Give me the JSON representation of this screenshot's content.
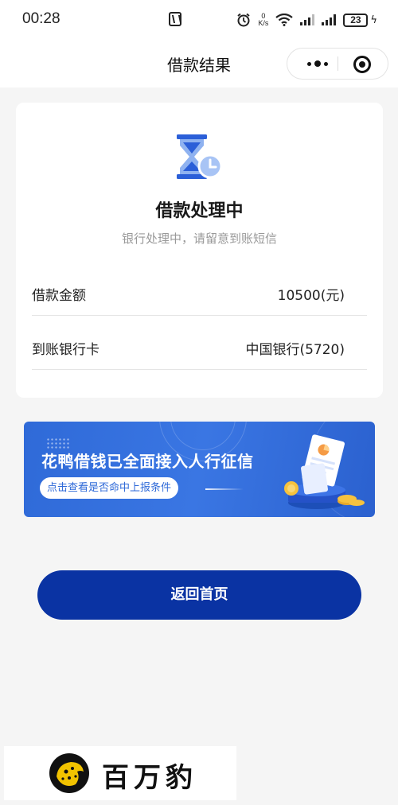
{
  "status_bar": {
    "time": "00:28",
    "net_speed_value": "0",
    "net_speed_unit": "K/s",
    "battery": "23"
  },
  "nav": {
    "title": "借款结果"
  },
  "result": {
    "title": "借款处理中",
    "subtitle": "银行处理中，请留意到账短信",
    "rows": [
      {
        "label": "借款金额",
        "value": "10500(元)"
      },
      {
        "label": "到账银行卡",
        "value": "中国银行(5720)"
      }
    ]
  },
  "banner": {
    "title": "花鸭借钱已全面接入人行征信",
    "button_label": "点击查看是否命中上报条件"
  },
  "actions": {
    "home_label": "返回首页"
  },
  "watermark": {
    "text": "百万豹"
  },
  "colors": {
    "primary": "#0a33a3",
    "banner": "#2f6ad8",
    "card_bg": "#ffffff",
    "page_bg": "#f5f5f5"
  }
}
